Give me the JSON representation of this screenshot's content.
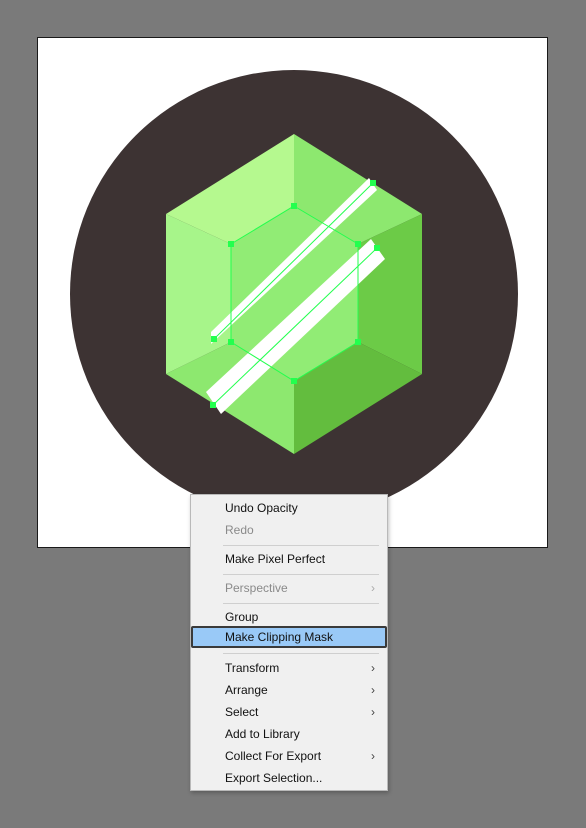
{
  "colors": {
    "workspace_bg": "#7a7a7a",
    "artboard_bg": "#ffffff",
    "circle": "#3d3333",
    "gem_light": "#b5f98f",
    "gem_mid": "#8de86f",
    "gem_dark": "#6ccb47",
    "selection": "#23ff4e",
    "menu_bg": "#f0f0f0",
    "menu_highlight": "#99c9f7"
  },
  "context_menu": {
    "items": [
      {
        "label": "Undo Opacity",
        "enabled": true,
        "submenu": false
      },
      {
        "label": "Redo",
        "enabled": false,
        "submenu": false
      },
      {
        "label": "Make Pixel Perfect",
        "enabled": true,
        "submenu": false
      },
      {
        "label": "Perspective",
        "enabled": false,
        "submenu": true
      },
      {
        "label": "Group",
        "enabled": true,
        "submenu": false
      },
      {
        "label": "Make Clipping Mask",
        "enabled": true,
        "submenu": false,
        "highlighted": true
      },
      {
        "label": "Transform",
        "enabled": true,
        "submenu": true
      },
      {
        "label": "Arrange",
        "enabled": true,
        "submenu": true
      },
      {
        "label": "Select",
        "enabled": true,
        "submenu": true
      },
      {
        "label": "Add to Library",
        "enabled": true,
        "submenu": false
      },
      {
        "label": "Collect For Export",
        "enabled": true,
        "submenu": true
      },
      {
        "label": "Export Selection...",
        "enabled": true,
        "submenu": false
      }
    ],
    "submenu_arrow": "›"
  }
}
